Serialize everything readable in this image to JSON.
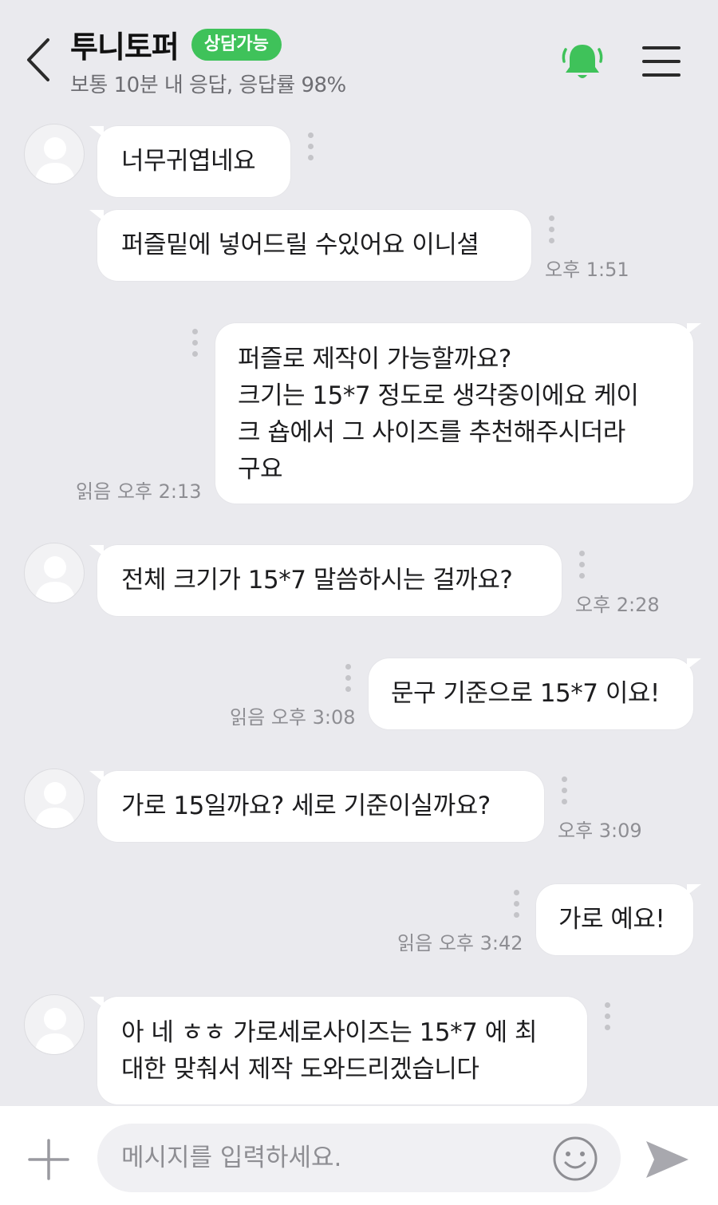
{
  "header": {
    "title": "투니토퍼",
    "status_badge": "상담가능",
    "subtitle": "보통 10분 내 응답, 응답률 98%",
    "icons": {
      "back": "chevron-left-icon",
      "bell": "bell-icon",
      "menu": "menu-icon"
    },
    "colors": {
      "accent": "#3fc25a"
    }
  },
  "messages": [
    {
      "side": "received",
      "text": "너무귀엽네요",
      "time": ""
    },
    {
      "side": "received",
      "text": "퍼즐밑에 넣어드릴 수있어요 이니셜",
      "time": "오후 1:51"
    },
    {
      "side": "sent",
      "lines": [
        "퍼즐로 제작이 가능할까요?",
        "크기는 15*7 정도로 생각중이에요 케이",
        "크 숍에서 그 사이즈를 추천해주시더라",
        "구요"
      ],
      "read": "읽음",
      "time": "오후 2:13"
    },
    {
      "side": "received",
      "text": "전체 크기가 15*7 말씀하시는 걸까요?",
      "time": "오후 2:28"
    },
    {
      "side": "sent",
      "text": "문구 기준으로 15*7 이요!",
      "read": "읽음",
      "time": "오후 3:08"
    },
    {
      "side": "received",
      "text": "가로 15일까요? 세로 기준이실까요?",
      "time": "오후 3:09"
    },
    {
      "side": "sent",
      "text": "가로 예요!",
      "read": "읽음",
      "time": "오후 3:42"
    },
    {
      "side": "received",
      "lines": [
        "아 네 ㅎㅎ 가로세로사이즈는 15*7 에 최",
        "대한 맞춰서 제작 도와드리겠습니다"
      ],
      "time": ""
    }
  ],
  "input": {
    "placeholder": "메시지를 입력하세요.",
    "icons": {
      "add": "plus-icon",
      "emoji": "smiley-icon",
      "send": "send-icon"
    }
  }
}
